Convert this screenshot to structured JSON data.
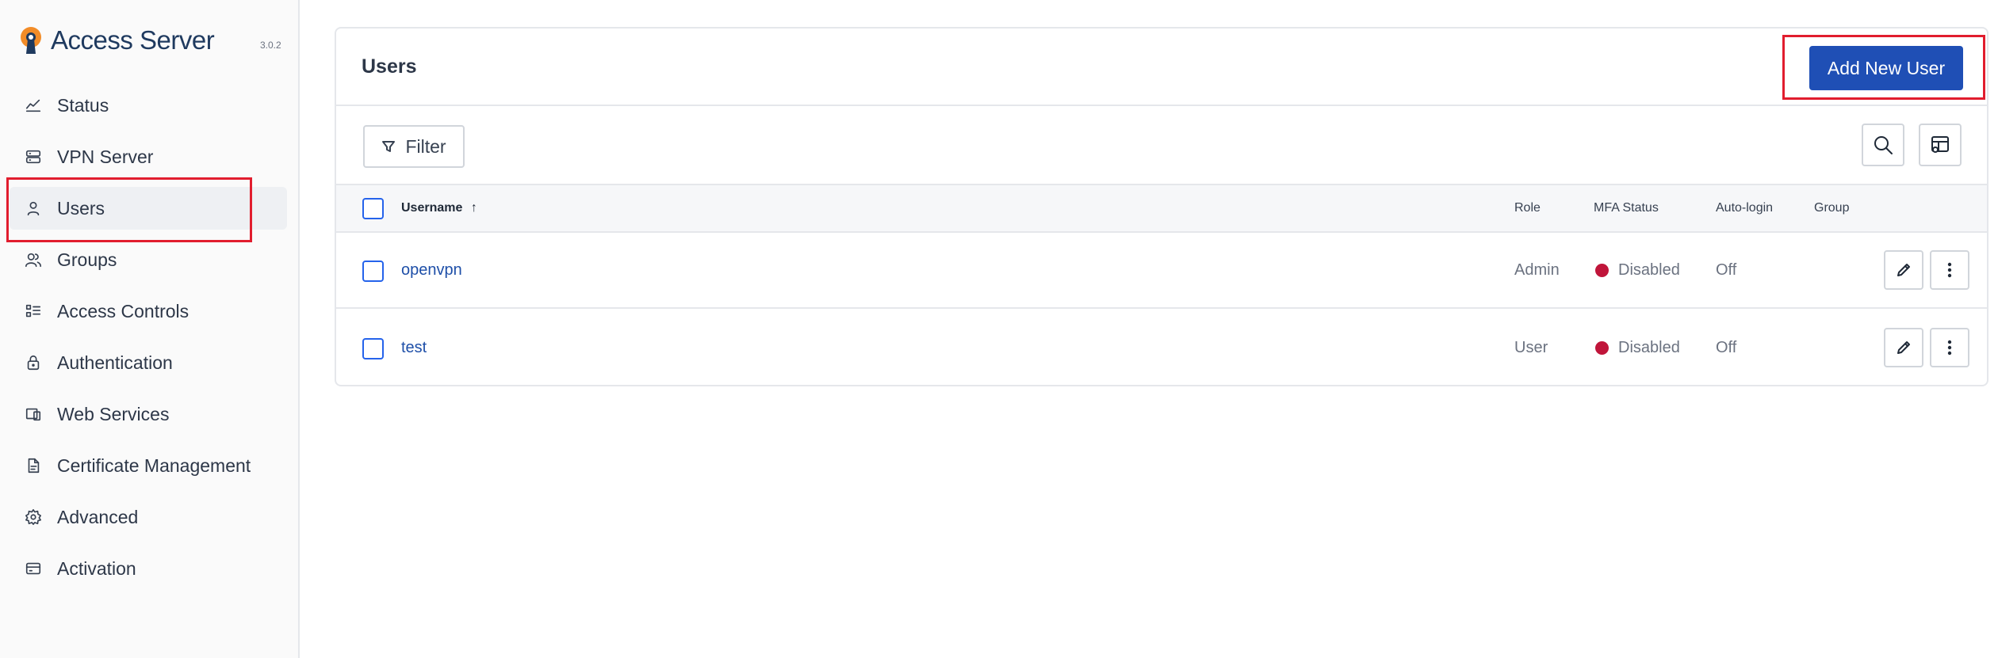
{
  "brand": {
    "name": "Access Server",
    "version": "3.0.2",
    "accent": "#f28c28"
  },
  "sidebar": {
    "items": [
      {
        "label": "Status",
        "icon": "status-chart-icon"
      },
      {
        "label": "VPN Server",
        "icon": "server-icon"
      },
      {
        "label": "Users",
        "icon": "user-icon",
        "active": true
      },
      {
        "label": "Groups",
        "icon": "groups-icon"
      },
      {
        "label": "Access Controls",
        "icon": "access-controls-icon"
      },
      {
        "label": "Authentication",
        "icon": "lock-icon"
      },
      {
        "label": "Web Services",
        "icon": "devices-icon"
      },
      {
        "label": "Certificate Management",
        "icon": "document-icon"
      },
      {
        "label": "Advanced",
        "icon": "gear-icon"
      },
      {
        "label": "Activation",
        "icon": "card-icon"
      }
    ]
  },
  "main": {
    "title": "Users",
    "add_button": "Add New User",
    "filter_label": "Filter",
    "table": {
      "headers": {
        "username": "Username",
        "role": "Role",
        "mfa": "MFA Status",
        "autologin": "Auto-login",
        "group": "Group"
      },
      "sort_indicator": "↑",
      "rows": [
        {
          "username": "openvpn",
          "role": "Admin",
          "mfa": "Disabled",
          "autologin": "Off",
          "group": ""
        },
        {
          "username": "test",
          "role": "User",
          "mfa": "Disabled",
          "autologin": "Off",
          "group": ""
        }
      ]
    }
  },
  "colors": {
    "primary": "#1f4fb5",
    "link": "#1e4fa8",
    "mfa_disabled": "#c0153a",
    "highlight": "#e11d2e"
  }
}
